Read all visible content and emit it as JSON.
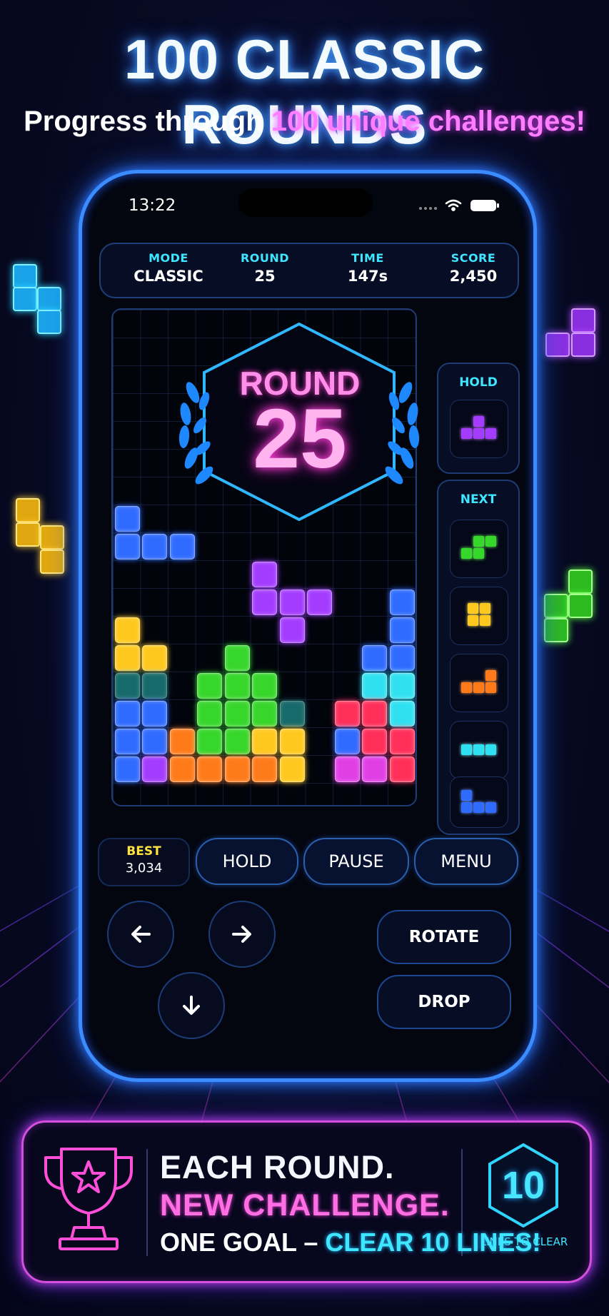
{
  "headline": "100 CLASSIC ROUNDS",
  "subheadline": {
    "part1": "Progress through ",
    "part2": "100 unique challenges!"
  },
  "status_bar": {
    "time": "13:22"
  },
  "stats": [
    {
      "label": "MODE",
      "value": "CLASSIC"
    },
    {
      "label": "ROUND",
      "value": "25"
    },
    {
      "label": "TIME",
      "value": "147s"
    },
    {
      "label": "SCORE",
      "value": "2,450"
    }
  ],
  "round_overlay": {
    "label": "ROUND",
    "number": "25"
  },
  "hold_panel": {
    "title": "HOLD",
    "piece": "T"
  },
  "next_panel": {
    "title": "NEXT",
    "pieces": [
      "S",
      "O",
      "L",
      "I",
      "J"
    ]
  },
  "best": {
    "label": "BEST",
    "value": "3,034"
  },
  "buttons": {
    "hold": "HOLD",
    "pause": "PAUSE",
    "menu": "MENU",
    "rotate": "ROTATE",
    "drop": "DROP"
  },
  "controls": {
    "left_icon": "arrow-left-icon",
    "right_icon": "arrow-right-icon",
    "down_icon": "arrow-down-icon"
  },
  "banner": {
    "line1": "EACH ROUND.",
    "line2": "NEW CHALLENGE.",
    "line3_part1": "ONE GOAL – ",
    "line3_part2": "CLEAR 10 LINES!",
    "badge_number": "10",
    "badge_caption": "LINES TO CLEAR"
  },
  "colors": {
    "blue": "#2f6bff",
    "purple": "#a43cff",
    "yellow": "#ffc81e",
    "green": "#36d62a",
    "cyan": "#2fe0f0",
    "teal": "#1d8c8a",
    "orange": "#ff7a18",
    "red": "#ff2f5a",
    "magenta": "#e03fe6",
    "accent_cyan": "#3fe6ff",
    "accent_pink": "#ff6fe3"
  }
}
